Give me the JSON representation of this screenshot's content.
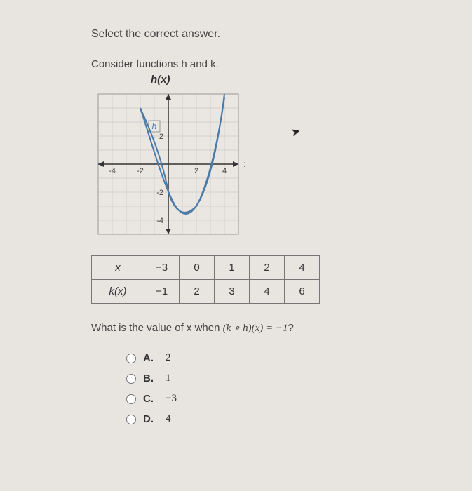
{
  "instruction": "Select the correct answer.",
  "context": "Consider functions h and k.",
  "graph": {
    "title": "h(x)",
    "xlabel": "x",
    "curve_label": "h",
    "xticks": [
      "-4",
      "-2",
      "2",
      "4"
    ],
    "yticks_pos": [
      "2"
    ],
    "yticks_neg": [
      "-2",
      "-4"
    ]
  },
  "table": {
    "row1_label": "x",
    "row1": [
      "−3",
      "0",
      "1",
      "2",
      "4"
    ],
    "row2_label": "k(x)",
    "row2": [
      "−1",
      "2",
      "3",
      "4",
      "6"
    ]
  },
  "question": {
    "prefix": "What is the value of x when ",
    "formula": "(k ∘ h)(x) = −1",
    "suffix": "?"
  },
  "options": {
    "a": {
      "label": "A.",
      "value": "2"
    },
    "b": {
      "label": "B.",
      "value": "1"
    },
    "c": {
      "label": "C.",
      "value": "−3"
    },
    "d": {
      "label": "D.",
      "value": "4"
    }
  },
  "chart_data": {
    "type": "line",
    "title": "h(x)",
    "xlabel": "x",
    "ylabel": "",
    "xlim": [
      -5,
      5
    ],
    "ylim": [
      -5,
      5
    ],
    "series": [
      {
        "name": "h",
        "x": [
          -2,
          -1,
          0,
          1,
          2,
          3,
          4
        ],
        "y": [
          4,
          0.5,
          -2,
          -3.5,
          -3,
          0,
          5
        ]
      }
    ]
  }
}
